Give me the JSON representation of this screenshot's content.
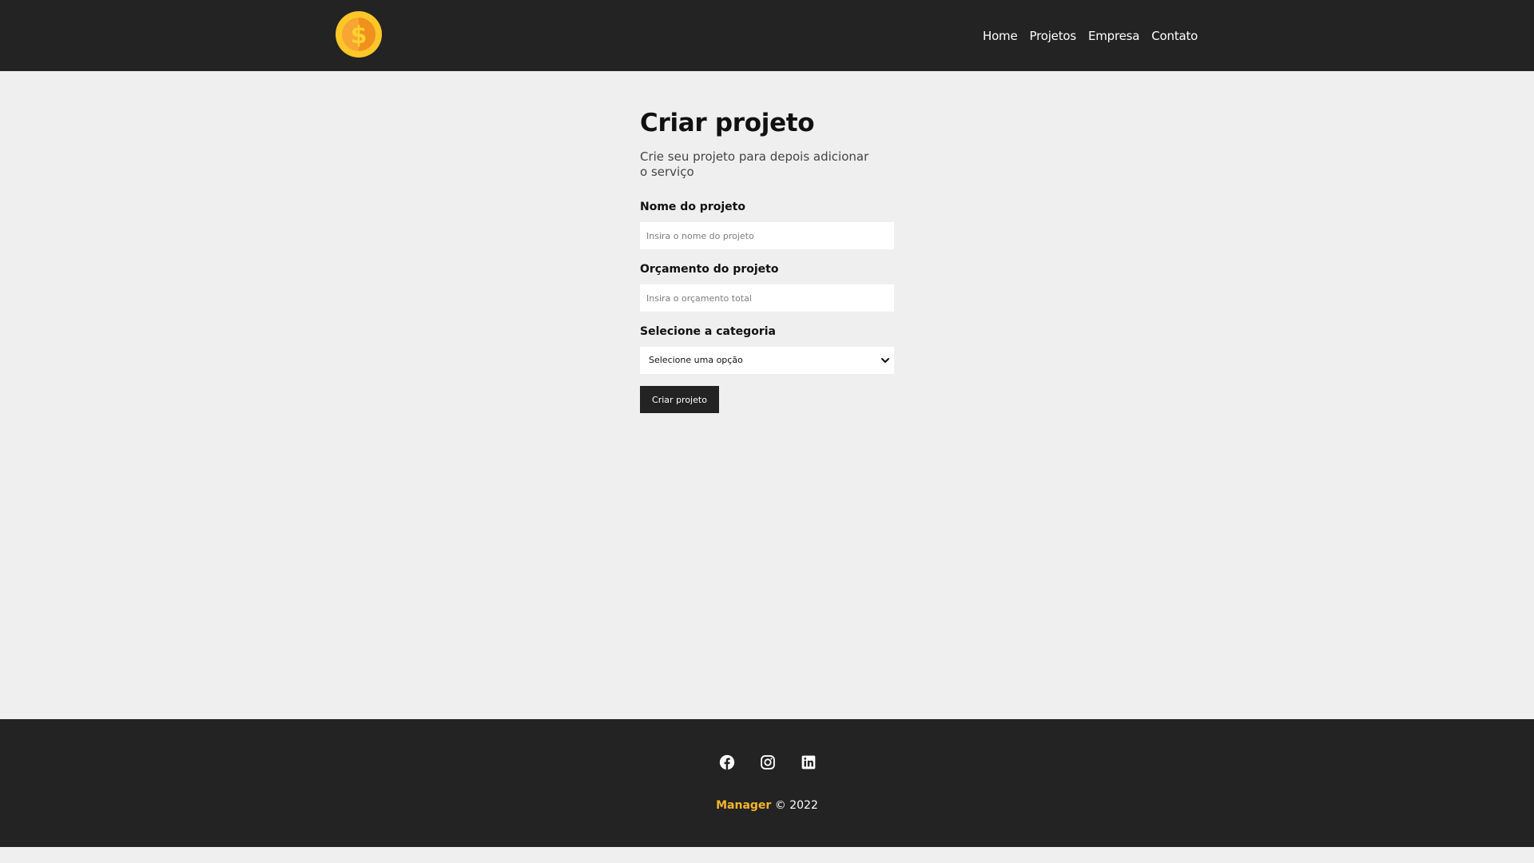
{
  "header": {
    "logo_icon": "coin-dollar-icon",
    "nav": [
      {
        "label": "Home"
      },
      {
        "label": "Projetos"
      },
      {
        "label": "Empresa"
      },
      {
        "label": "Contato"
      }
    ]
  },
  "main": {
    "title": "Criar projeto",
    "subtitle": "Crie seu projeto para depois adicionar o serviço",
    "form": {
      "name_label": "Nome do projeto",
      "name_placeholder": "Insira o nome do projeto",
      "budget_label": "Orçamento do projeto",
      "budget_placeholder": "Insira o orçamento total",
      "category_label": "Selecione a categoria",
      "category_selected": "Selecione uma opção",
      "submit_label": "Criar projeto"
    }
  },
  "footer": {
    "social": [
      {
        "icon": "facebook-icon"
      },
      {
        "icon": "instagram-icon"
      },
      {
        "icon": "linkedin-icon"
      }
    ],
    "brand": "Manager",
    "copyright_suffix": "© 2022"
  },
  "colors": {
    "header_bg": "#232323",
    "page_bg": "#efefef",
    "accent": "#f7b52b",
    "button_bg": "#232323"
  }
}
